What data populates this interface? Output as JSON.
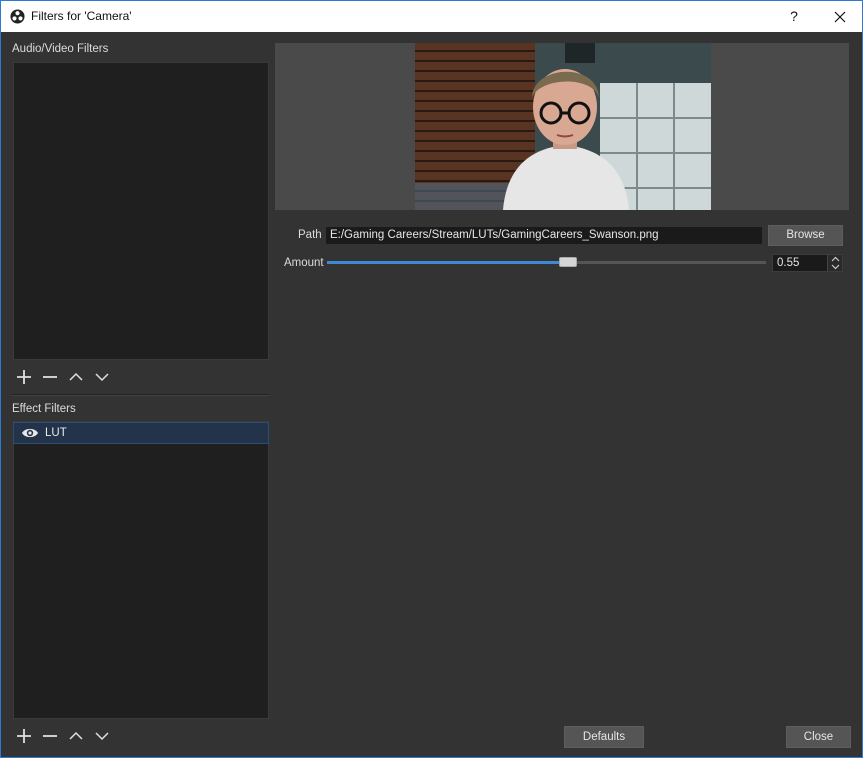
{
  "window": {
    "title": "Filters for 'Camera'",
    "help_label": "?",
    "close_icon": "close-icon",
    "app_icon": "obs-logo-icon"
  },
  "audio_video": {
    "heading": "Audio/Video Filters",
    "items": [],
    "toolbar": [
      "add-icon",
      "remove-icon",
      "move-up-icon",
      "move-down-icon"
    ]
  },
  "effects": {
    "heading": "Effect Filters",
    "items": [
      {
        "label": "LUT",
        "visible": true,
        "selected": true,
        "icon": "eye-icon"
      }
    ],
    "toolbar": [
      "add-icon",
      "remove-icon",
      "move-up-icon",
      "move-down-icon"
    ]
  },
  "properties": {
    "path_label": "Path",
    "path_value": "E:/Gaming Careers/Stream/LUTs/GamingCareers_Swanson.png",
    "browse_label": "Browse",
    "amount_label": "Amount",
    "amount_value": "0.55",
    "amount_fraction": 0.55
  },
  "footer": {
    "defaults_label": "Defaults",
    "close_label": "Close"
  },
  "colors": {
    "accent": "#3f88d6",
    "selection": "#23344a",
    "panel": "#1f1f1f",
    "background": "#333333"
  }
}
